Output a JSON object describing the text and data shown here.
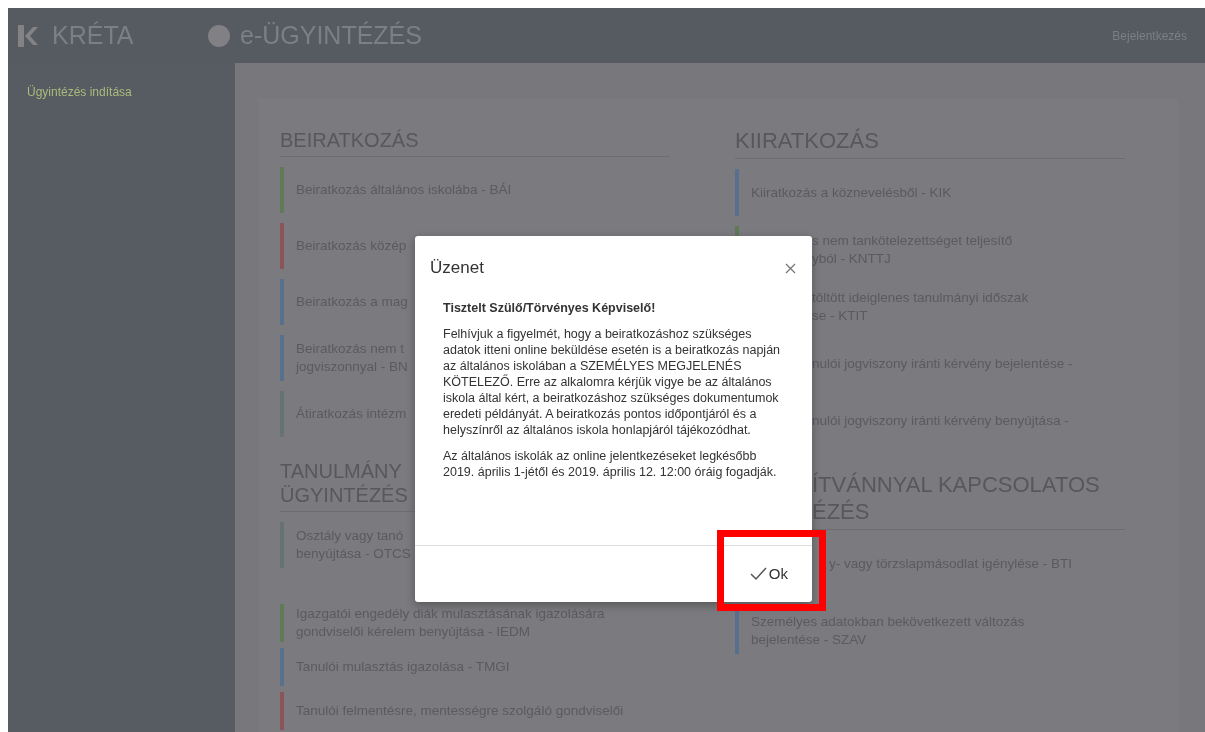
{
  "header": {
    "logo_text": "KRÉTA",
    "title": "e-ÜGYINTÉZÉS",
    "login": "Bejelentkezés"
  },
  "sidebar": {
    "items": [
      {
        "label": "Ügyintézés indítása",
        "selected": true
      }
    ]
  },
  "columns": [
    [
      {
        "heading": [
          "BEIRATKOZÁS"
        ],
        "kind": "full",
        "items": [
          {
            "lines": [
              "Beiratkozás általános iskolába - BÁI"
            ],
            "color": "#5f7a57",
            "kind": "full"
          },
          {
            "lines": [
              "Beiratkozás közép"
            ],
            "color": "#8a5458",
            "kind": "full"
          },
          {
            "lines": [
              "Beiratkozás a mag"
            ],
            "color": "#56708e",
            "kind": "full"
          },
          {
            "lines": [
              "Beiratkozás nem t",
              "jogviszonnyal - BN"
            ],
            "color": "#56708e",
            "kind": "full"
          },
          {
            "lines": [
              "Átiratkozás intézm"
            ],
            "color": "#667370",
            "kind": "full"
          }
        ]
      },
      {
        "heading": [
          "TANULMÁNY",
          "ÜGYINTÉZÉS"
        ],
        "kind": "full",
        "items": [
          {
            "lines": [
              "Osztály vagy tanó",
              "benyújtása - OTCS"
            ],
            "color": "#667370",
            "kind": "full"
          },
          {
            "lines": [
              "Igazgatói engedély diák mulasztásának igazolására",
              "gondviselői kérelem benyújtása - IEDM"
            ],
            "color": "#5f7a57",
            "kind": "full"
          },
          {
            "lines": [
              "Tanulói mulasztás igazolása - TMGI"
            ],
            "color": "#56708e",
            "kind": "full"
          },
          {
            "lines": [
              "Tanulói felmentésre, mentességre szolgáló gondviselői"
            ],
            "color": "#8a5458",
            "kind": "full"
          }
        ]
      }
    ],
    [
      {
        "heading": [
          "KIIRATKOZÁS"
        ],
        "kind": "full",
        "items": [
          {
            "lines": [
              "Kiiratkozás a köznevelésből - KIK"
            ],
            "color": "#56708e",
            "kind": "full"
          },
          {
            "lines": [
              "s nem tankötelezettséget teljesítő",
              "yból - KNTTJ"
            ],
            "color": "#5f7a57",
            "kind": "partial"
          },
          {
            "lines": [
              "töltött ideiglenes tanulmányi időszak",
              "se - KTIT"
            ],
            "kind": "partial"
          },
          {
            "lines": [
              "nulói jogviszony iránti kérvény bejelentése -"
            ],
            "kind": "partial"
          },
          {
            "lines": [
              "nulói jogviszony iránti kérvény benyújtása -"
            ],
            "kind": "partial"
          }
        ]
      },
      {
        "heading": [
          "ÍTVÁNNYAL KAPCSOLATOS",
          "ÉZÉS"
        ],
        "kind": "partial",
        "items": [
          {
            "lines": [
              "y- vagy törzslapmásodlat igénylése - BTI"
            ],
            "kind": "partial"
          },
          {
            "lines": [
              "Személyes adatokban bekövetkezett változás",
              "bejelentése - SZAV"
            ],
            "color": "#56708e",
            "kind": "full"
          }
        ]
      }
    ]
  ],
  "modal": {
    "title": "Üzenet",
    "greeting": "Tisztelt Szülő/Törvényes Képviselő!",
    "paragraphs": [
      "Felhívjuk a figyelmét, hogy a beiratkozáshoz szükséges adatok itteni online beküldése esetén is a beiratkozás napján az általános iskolában a SZEMÉLYES MEGJELENÉS KÖTELEZŐ. Erre az alkalomra kérjük vigye be az általános iskola által kért, a beiratkozáshoz szükséges dokumentumok eredeti példányát. A beiratkozás pontos időpontjáról és a helyszínről az általános iskola honlapjáról tájékozódhat.",
      "Az általános iskolák az online jelentkezéseket legkésőbb 2019. április 1-jétől és 2019. április 12. 12:00 óráig fogadják."
    ],
    "ok_button": "Ok"
  }
}
